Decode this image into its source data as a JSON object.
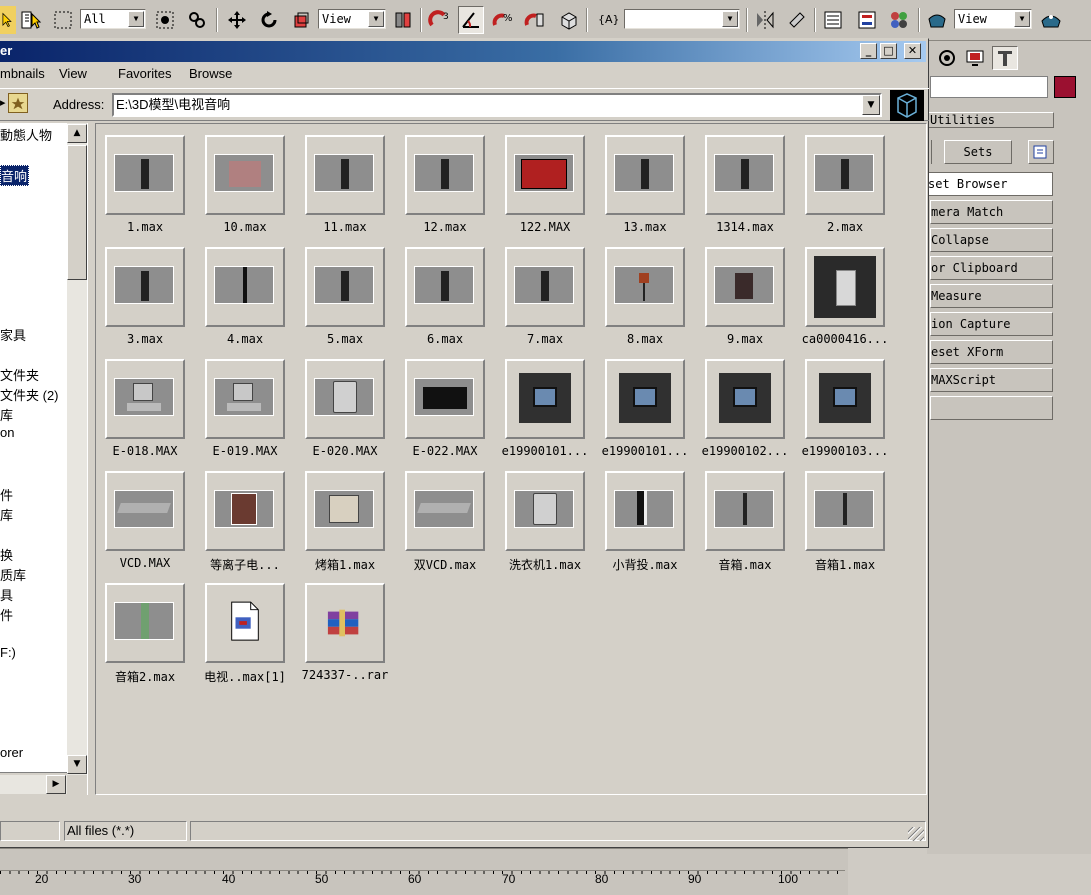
{
  "toolbar": {
    "selection_filter": "All",
    "ref_coord": "View",
    "named_set": "",
    "ref_coord2": "View",
    "snap_angle_label": "3"
  },
  "window": {
    "title": "er",
    "menu": [
      "mbnails",
      "View",
      "Favorites",
      "Browse"
    ],
    "address_label": "Address:",
    "address_value": "E:\\3D模型\\电视音响"
  },
  "tree": {
    "items": [
      {
        "label": "動態人物",
        "top": 0
      },
      {
        "label": "音响",
        "selected": true
      },
      {
        "label": "家具"
      },
      {
        "label": "文件夹"
      },
      {
        "label": "文件夹 (2)"
      },
      {
        "label": "库"
      },
      {
        "label": "on"
      },
      {
        "label": "件"
      },
      {
        "label": "库"
      },
      {
        "label": "换"
      },
      {
        "label": "质库"
      },
      {
        "label": "具"
      },
      {
        "label": "件"
      },
      {
        "label": "F:)"
      },
      {
        "label": "orer"
      }
    ]
  },
  "files": [
    {
      "name": "1.max"
    },
    {
      "name": "10.max"
    },
    {
      "name": "11.max"
    },
    {
      "name": "12.max"
    },
    {
      "name": "122.MAX"
    },
    {
      "name": "13.max"
    },
    {
      "name": "1314.max"
    },
    {
      "name": "2.max"
    },
    {
      "name": "3.max"
    },
    {
      "name": "4.max"
    },
    {
      "name": "5.max"
    },
    {
      "name": "6.max"
    },
    {
      "name": "7.max"
    },
    {
      "name": "8.max"
    },
    {
      "name": "9.max"
    },
    {
      "name": "ca0000416..."
    },
    {
      "name": "E-018.MAX"
    },
    {
      "name": "E-019.MAX"
    },
    {
      "name": "E-020.MAX"
    },
    {
      "name": "E-022.MAX"
    },
    {
      "name": "e19900101..."
    },
    {
      "name": "e19900101..."
    },
    {
      "name": "e19900102..."
    },
    {
      "name": "e19900103..."
    },
    {
      "name": "VCD.MAX"
    },
    {
      "name": "等离子电..."
    },
    {
      "name": "烤箱1.max"
    },
    {
      "name": "双VCD.max"
    },
    {
      "name": "洗衣机1.max"
    },
    {
      "name": "小背投.max"
    },
    {
      "name": "音箱.max"
    },
    {
      "name": "音箱1.max"
    },
    {
      "name": "音箱2.max"
    },
    {
      "name": "电视..max[1]"
    },
    {
      "name": "724337-..rar"
    }
  ],
  "status": {
    "filter": "All files (*.*)"
  },
  "utilities": {
    "header": "Utilities",
    "sets": "Sets",
    "buttons": [
      "set Browser",
      "mera Match",
      "Collapse",
      "or Clipboard",
      "Measure",
      "ion Capture",
      "eset XForm",
      "MAXScript",
      ""
    ]
  },
  "timeline": {
    "ticks": [
      "20",
      "30",
      "40",
      "50",
      "60",
      "70",
      "80",
      "90",
      "100"
    ]
  },
  "colors": {
    "accent_swatch": "#9b1030",
    "title_gradient_start": "#0a246a"
  }
}
